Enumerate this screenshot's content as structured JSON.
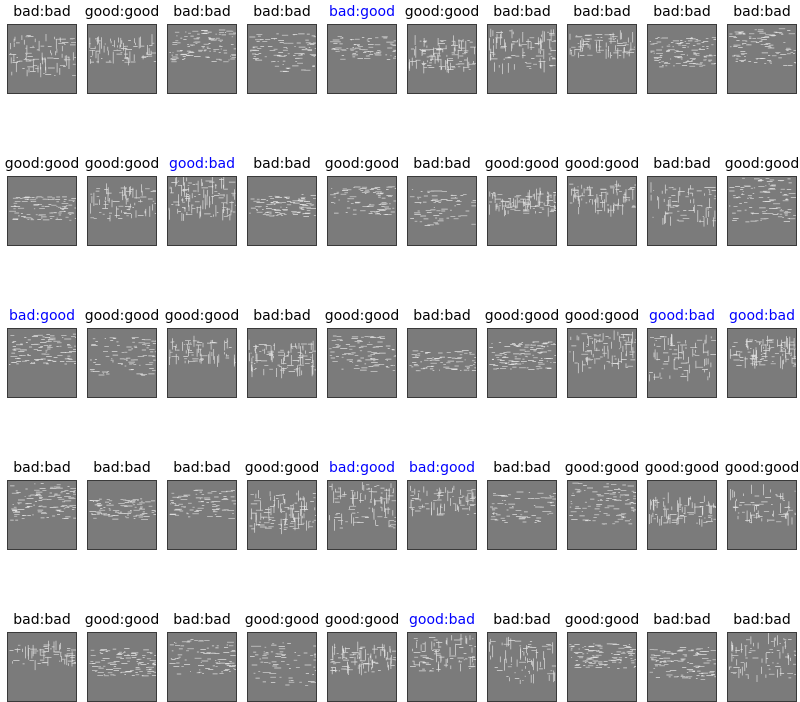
{
  "colors": {
    "match": "#000000",
    "mismatch": "#0000ff",
    "thumb_bg": "#7b7b7b",
    "thumb_border": "#3a3a3a",
    "stroke_light": "#ffffff"
  },
  "grid": {
    "rows": [
      {
        "cells": [
          {
            "label": "bad:bad",
            "true": "bad",
            "pred": "bad"
          },
          {
            "label": "good:good",
            "true": "good",
            "pred": "good"
          },
          {
            "label": "bad:bad",
            "true": "bad",
            "pred": "bad"
          },
          {
            "label": "bad:bad",
            "true": "bad",
            "pred": "bad"
          },
          {
            "label": "bad:good",
            "true": "bad",
            "pred": "good"
          },
          {
            "label": "good:good",
            "true": "good",
            "pred": "good"
          },
          {
            "label": "bad:bad",
            "true": "bad",
            "pred": "bad"
          },
          {
            "label": "bad:bad",
            "true": "bad",
            "pred": "bad"
          },
          {
            "label": "bad:bad",
            "true": "bad",
            "pred": "bad"
          },
          {
            "label": "bad:bad",
            "true": "bad",
            "pred": "bad"
          }
        ]
      },
      {
        "cells": [
          {
            "label": "good:good",
            "true": "good",
            "pred": "good"
          },
          {
            "label": "good:good",
            "true": "good",
            "pred": "good"
          },
          {
            "label": "good:bad",
            "true": "good",
            "pred": "bad"
          },
          {
            "label": "bad:bad",
            "true": "bad",
            "pred": "bad"
          },
          {
            "label": "good:good",
            "true": "good",
            "pred": "good"
          },
          {
            "label": "bad:bad",
            "true": "bad",
            "pred": "bad"
          },
          {
            "label": "good:good",
            "true": "good",
            "pred": "good"
          },
          {
            "label": "good:good",
            "true": "good",
            "pred": "good"
          },
          {
            "label": "bad:bad",
            "true": "bad",
            "pred": "bad"
          },
          {
            "label": "good:good",
            "true": "good",
            "pred": "good"
          }
        ]
      },
      {
        "cells": [
          {
            "label": "bad:good",
            "true": "bad",
            "pred": "good"
          },
          {
            "label": "good:good",
            "true": "good",
            "pred": "good"
          },
          {
            "label": "good:good",
            "true": "good",
            "pred": "good"
          },
          {
            "label": "bad:bad",
            "true": "bad",
            "pred": "bad"
          },
          {
            "label": "good:good",
            "true": "good",
            "pred": "good"
          },
          {
            "label": "bad:bad",
            "true": "bad",
            "pred": "bad"
          },
          {
            "label": "good:good",
            "true": "good",
            "pred": "good"
          },
          {
            "label": "good:good",
            "true": "good",
            "pred": "good"
          },
          {
            "label": "good:bad",
            "true": "good",
            "pred": "bad"
          },
          {
            "label": "good:bad",
            "true": "good",
            "pred": "bad"
          }
        ]
      },
      {
        "cells": [
          {
            "label": "bad:bad",
            "true": "bad",
            "pred": "bad"
          },
          {
            "label": "bad:bad",
            "true": "bad",
            "pred": "bad"
          },
          {
            "label": "bad:bad",
            "true": "bad",
            "pred": "bad"
          },
          {
            "label": "good:good",
            "true": "good",
            "pred": "good"
          },
          {
            "label": "bad:good",
            "true": "bad",
            "pred": "good"
          },
          {
            "label": "bad:good",
            "true": "bad",
            "pred": "good"
          },
          {
            "label": "bad:bad",
            "true": "bad",
            "pred": "bad"
          },
          {
            "label": "good:good",
            "true": "good",
            "pred": "good"
          },
          {
            "label": "good:good",
            "true": "good",
            "pred": "good"
          },
          {
            "label": "good:good",
            "true": "good",
            "pred": "good"
          }
        ]
      },
      {
        "cells": [
          {
            "label": "bad:bad",
            "true": "bad",
            "pred": "bad"
          },
          {
            "label": "good:good",
            "true": "good",
            "pred": "good"
          },
          {
            "label": "bad:bad",
            "true": "bad",
            "pred": "bad"
          },
          {
            "label": "good:good",
            "true": "good",
            "pred": "good"
          },
          {
            "label": "good:good",
            "true": "good",
            "pred": "good"
          },
          {
            "label": "good:bad",
            "true": "good",
            "pred": "bad"
          },
          {
            "label": "bad:bad",
            "true": "bad",
            "pred": "bad"
          },
          {
            "label": "good:good",
            "true": "good",
            "pred": "good"
          },
          {
            "label": "bad:bad",
            "true": "bad",
            "pred": "bad"
          },
          {
            "label": "bad:bad",
            "true": "bad",
            "pred": "bad"
          }
        ]
      }
    ]
  }
}
